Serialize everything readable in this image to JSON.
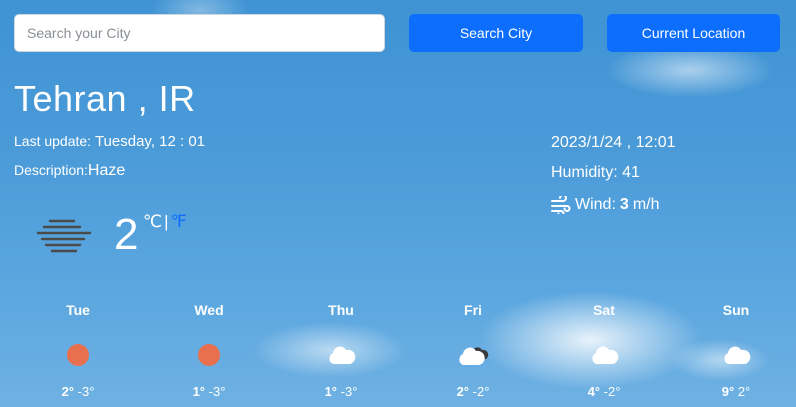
{
  "search": {
    "placeholder": "Search your City",
    "value": "",
    "search_button_label": "Search City",
    "location_button_label": "Current Location"
  },
  "current": {
    "city": "Tehran , IR",
    "last_update_label": "Last update:",
    "last_update_value": "Tuesday, 12 : 01",
    "description_label": "Description:",
    "description_value": "Haze",
    "icon": "haze-icon",
    "temperature": "2",
    "unit_c": "℃",
    "unit_sep": "|",
    "unit_f": "℉",
    "datetime": "2023/1/24 , 12:01",
    "humidity_label": "Humidity:",
    "humidity_value": "41",
    "wind_label": "Wind:",
    "wind_speed": "3",
    "wind_unit": "m/h"
  },
  "forecast": [
    {
      "day": "Tue",
      "icon": "sun-icon",
      "max": "2°",
      "min": "-3°"
    },
    {
      "day": "Wed",
      "icon": "sun-icon",
      "max": "1°",
      "min": "-3°"
    },
    {
      "day": "Thu",
      "icon": "cloud-icon",
      "max": "1°",
      "min": "-3°"
    },
    {
      "day": "Fri",
      "icon": "dark-cloud-icon",
      "max": "2°",
      "min": "-2°"
    },
    {
      "day": "Sat",
      "icon": "cloud-icon",
      "max": "4°",
      "min": "-2°"
    },
    {
      "day": "Sun",
      "icon": "cloud-icon",
      "max": "9°",
      "min": "2°"
    }
  ],
  "colors": {
    "accent": "#0d6efd",
    "sun": "#e8704f",
    "sky": "#4a9ad8"
  }
}
